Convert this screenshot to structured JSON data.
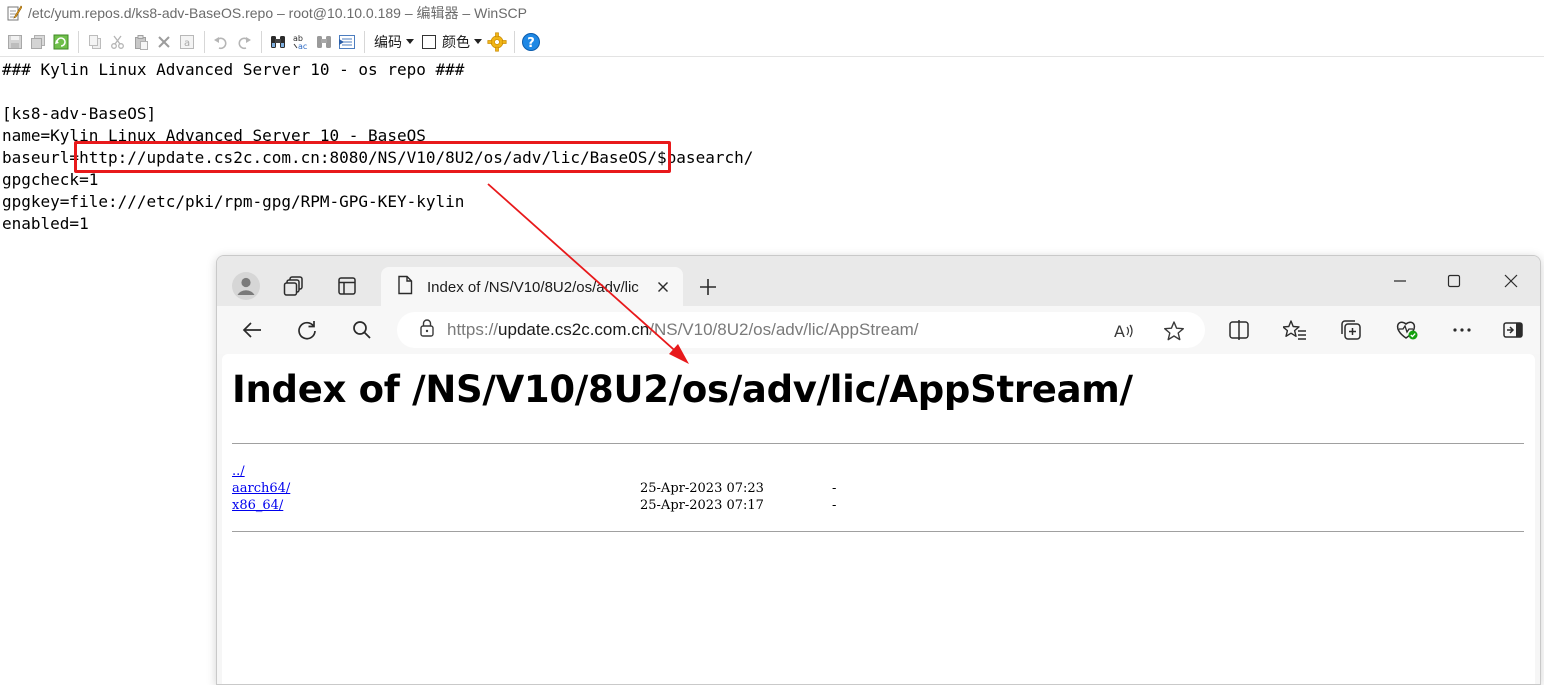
{
  "editor": {
    "title": "/etc/yum.repos.d/ks8-adv-BaseOS.repo – root@10.10.0.189 – 编辑器 – WinSCP",
    "toolbar": {
      "encoding_label": "编码",
      "color_label": "颜色"
    },
    "lines": [
      "### Kylin Linux Advanced Server 10 - os repo ###",
      "",
      "[ks8-adv-BaseOS]",
      "name=Kylin Linux Advanced Server 10 - BaseOS",
      "baseurl=http://update.cs2c.com.cn:8080/NS/V10/8U2/os/adv/lic/BaseOS/$basearch/",
      "gpgcheck=1",
      "gpgkey=file:///etc/pki/rpm-gpg/RPM-GPG-KEY-kylin",
      "enabled=1"
    ]
  },
  "annotation": {
    "highlight_color": "#e8191b"
  },
  "browser": {
    "tab_title": "Index of /NS/V10/8U2/os/adv/lic",
    "url_scheme": "https://",
    "url_host": "update.cs2c.com.cn",
    "url_path": "/NS/V10/8U2/os/adv/lic/AppStream/",
    "page": {
      "heading": "Index of /NS/V10/8U2/os/adv/lic/AppStream/",
      "entries": [
        {
          "name": "../",
          "date": "",
          "size": ""
        },
        {
          "name": "aarch64/",
          "date": "25-Apr-2023 07:23",
          "size": "-"
        },
        {
          "name": "x86_64/",
          "date": "25-Apr-2023 07:17",
          "size": "-"
        }
      ]
    }
  }
}
